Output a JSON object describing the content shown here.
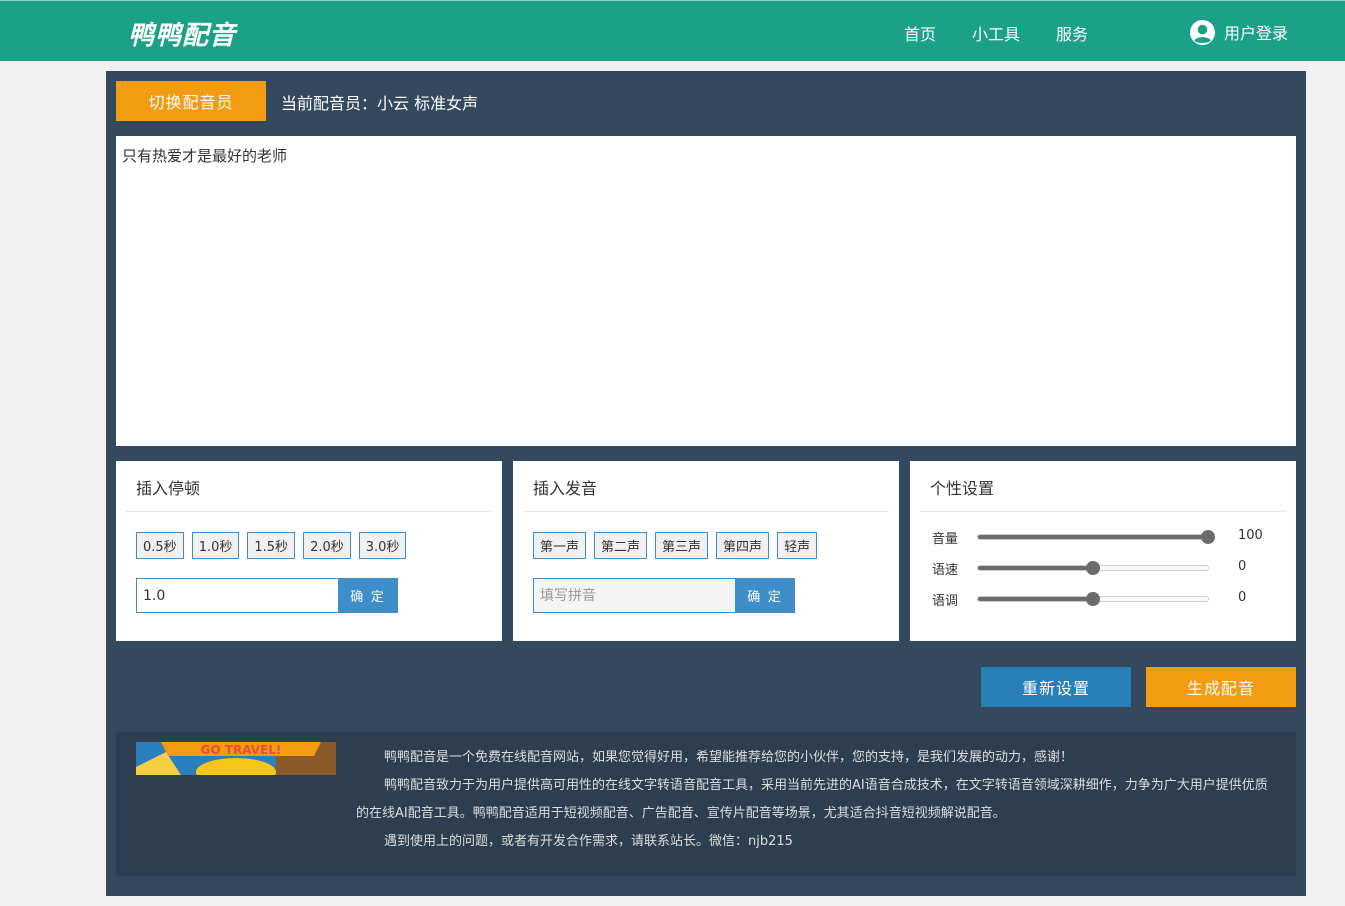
{
  "header": {
    "logo": "鸭鸭配音",
    "nav": [
      "首页",
      "小工具",
      "服务"
    ],
    "login": "用户登录"
  },
  "voice": {
    "switch_label": "切换配音员",
    "current": "当前配音员：小云 标准女声"
  },
  "editor": {
    "text": "只有热爱才是最好的老师"
  },
  "pause": {
    "title": "插入停顿",
    "tags": [
      "0.5秒",
      "1.0秒",
      "1.5秒",
      "2.0秒",
      "3.0秒"
    ],
    "value": "1.0",
    "confirm": "确 定"
  },
  "pron": {
    "title": "插入发音",
    "tags": [
      "第一声",
      "第二声",
      "第三声",
      "第四声",
      "轻声"
    ],
    "placeholder": "填写拼音",
    "confirm": "确 定"
  },
  "custom": {
    "title": "个性设置",
    "sliders": [
      {
        "label": "音量",
        "value": "100",
        "fraction": 1.0
      },
      {
        "label": "语速",
        "value": "0",
        "fraction": 0.5
      },
      {
        "label": "语调",
        "value": "0",
        "fraction": 0.5
      }
    ]
  },
  "actions": {
    "reset": "重新设置",
    "generate": "生成配音"
  },
  "info": {
    "lines": [
      "鸭鸭配音是一个免费在线配音网站，如果您觉得好用，希望能推荐给您的小伙伴，您的支持，是我们发展的动力，感谢！",
      "鸭鸭配音致力于为用户提供高可用性的在线文字转语音配音工具，采用当前先进的AI语音合成技术，在文字转语音领域深耕细作，力争为广大用户提供优质的在线AI配音工具。鸭鸭配音适用于短视频配音、广告配音、宣传片配音等场景，尤其适合抖音短视频解说配音。",
      "遇到使用上的问题，或者有开发合作需求，请联系站长。微信：njb215"
    ],
    "banner_text": "GO TRAVEL!"
  },
  "colors": {
    "header": "#1aa187",
    "panel": "#34495e",
    "accent_orange": "#f39c12",
    "accent_blue": "#2980b9"
  }
}
